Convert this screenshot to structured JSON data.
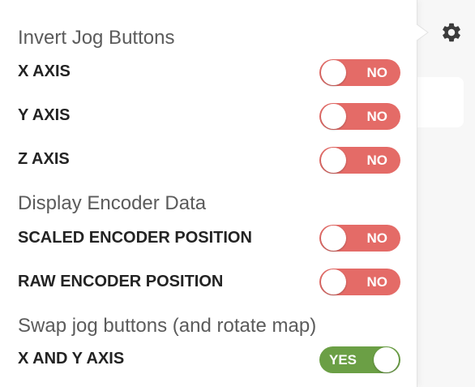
{
  "sections": {
    "invert_jog": {
      "title": "Invert Jog Buttons",
      "rows": [
        {
          "label": "X AXIS",
          "value": "NO"
        },
        {
          "label": "Y AXIS",
          "value": "NO"
        },
        {
          "label": "Z AXIS",
          "value": "NO"
        }
      ]
    },
    "encoder": {
      "title": "Display Encoder Data",
      "rows": [
        {
          "label": "SCALED ENCODER POSITION",
          "value": "NO"
        },
        {
          "label": "RAW ENCODER POSITION",
          "value": "NO"
        }
      ]
    },
    "swap": {
      "title": "Swap jog buttons (and rotate map)",
      "rows": [
        {
          "label": "X AND Y AXIS",
          "value": "YES"
        }
      ]
    }
  },
  "icons": {
    "settings": "gear-icon"
  },
  "colors": {
    "toggle_off": "#e46b67",
    "toggle_on": "#6b9f45",
    "title_text": "#5b5b5b",
    "label_text": "#232323"
  }
}
